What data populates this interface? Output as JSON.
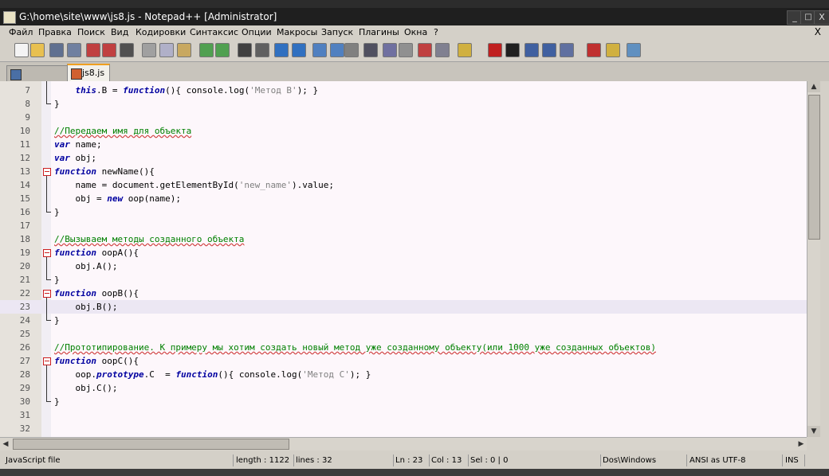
{
  "window": {
    "title": "G:\\home\\site\\www\\js8.js - Notepad++ [Administrator]",
    "minimize": "_",
    "maximize": "□",
    "close": "X"
  },
  "menu": {
    "items": [
      "Файл",
      "Правка",
      "Поиск",
      "Вид",
      "Кодировки",
      "Синтаксис",
      "Опции",
      "Макросы",
      "Запуск",
      "Плагины",
      "Окна",
      "?"
    ],
    "close": "X"
  },
  "tabs": [
    {
      "label": ""
    },
    {
      "label": "js8.js"
    }
  ],
  "editor": {
    "caret_line": 23,
    "lines": [
      {
        "n": "7",
        "html": "    <span class=\"kw\">this</span>.B = <span class=\"kw\">function</span>(){ console.log(<span class=\"str\">'Метод B'</span>); }"
      },
      {
        "n": "8",
        "html": "}"
      },
      {
        "n": "9",
        "html": ""
      },
      {
        "n": "10",
        "html": "<span class=\"cm\">//Передаем имя для объекта</span>"
      },
      {
        "n": "11",
        "html": "<span class=\"kw\">var</span> name;"
      },
      {
        "n": "12",
        "html": "<span class=\"kw\">var</span> obj;"
      },
      {
        "n": "13",
        "html": "<span class=\"kw\">function</span> newName(){"
      },
      {
        "n": "14",
        "html": "    name = document.getElementById(<span class=\"str\">'new_name'</span>).value;"
      },
      {
        "n": "15",
        "html": "    obj = <span class=\"kw\">new</span> oop(name);"
      },
      {
        "n": "16",
        "html": "}"
      },
      {
        "n": "17",
        "html": ""
      },
      {
        "n": "18",
        "html": "<span class=\"cm\">//Вызываем методы созданного объекта</span>"
      },
      {
        "n": "19",
        "html": "<span class=\"kw\">function</span> oopA(){"
      },
      {
        "n": "20",
        "html": "    obj.A();"
      },
      {
        "n": "21",
        "html": "}"
      },
      {
        "n": "22",
        "html": "<span class=\"kw\">function</span> oopB(){"
      },
      {
        "n": "23",
        "html": "    obj.B();"
      },
      {
        "n": "24",
        "html": "}"
      },
      {
        "n": "25",
        "html": ""
      },
      {
        "n": "26",
        "html": "<span class=\"cm\">//Прототипирование. К примеру мы хотим создать новый метод уже созданному объекту(или 1000 уже созданных объектов)</span>"
      },
      {
        "n": "27",
        "html": "<span class=\"kw\">function</span> oopC(){"
      },
      {
        "n": "28",
        "html": "    oop.<span class=\"kw\">prototype</span>.C  = <span class=\"kw\">function</span>(){ console.log(<span class=\"str\">'Метод C'</span>); }"
      },
      {
        "n": "29",
        "html": "    obj.C();"
      },
      {
        "n": "30",
        "html": "}"
      },
      {
        "n": "31",
        "html": ""
      },
      {
        "n": "32",
        "html": ""
      }
    ]
  },
  "status": {
    "filetype": "JavaScript file",
    "length": "length : 1122",
    "lines": "lines : 32",
    "ln": "Ln : 23",
    "col": "Col : 13",
    "sel": "Sel : 0 | 0",
    "eol": "Dos\\Windows",
    "encoding": "ANSI as UTF-8",
    "mode": "INS"
  },
  "toolbar_icons": [
    "new-file-icon",
    "open-file-icon",
    "save-icon",
    "save-all-icon",
    "close-icon",
    "close-all-icon",
    "print-icon",
    "cut-icon",
    "copy-icon",
    "paste-icon",
    "undo-icon",
    "redo-icon",
    "find-icon",
    "replace-icon",
    "zoom-in-icon",
    "zoom-out-icon",
    "sync-v-icon",
    "sync-h-icon",
    "wrap-icon",
    "all-chars-icon",
    "indent-guide-icon",
    "udl-icon",
    "doc-map-icon",
    "func-list-icon",
    "folder-icon",
    "record-macro-icon",
    "stop-macro-icon",
    "play-macro-icon",
    "play-multi-icon",
    "save-macro-icon",
    "spellcheck-icon",
    "spell-folder-icon",
    "spell-settings-icon"
  ]
}
